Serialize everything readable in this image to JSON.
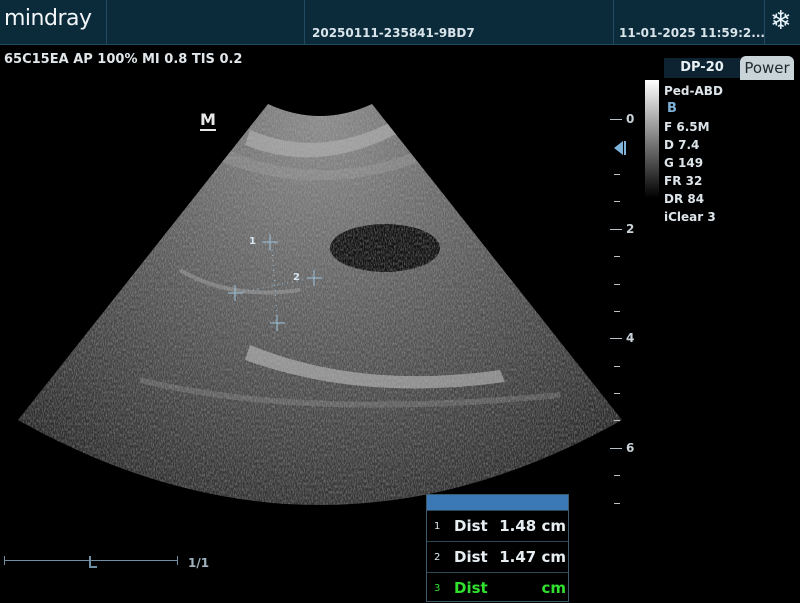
{
  "header": {
    "brand": "mindray",
    "patient_id": "20250111-235841-9BD7",
    "datetime": "11-01-2025 11:59:2...",
    "freeze_icon": "snowflake-icon"
  },
  "probe_info": "65C15EA AP 100%  MI 0.8 TIS 0.2",
  "orientation_marker": "M",
  "depth_scale": {
    "labels": [
      "0",
      "2",
      "4",
      "6"
    ]
  },
  "right_panel": {
    "tab_dp": "DP-20",
    "tab_power": "Power",
    "preset": "Ped-ABD",
    "mode": "B",
    "params": [
      "F 6.5M",
      "D 7.4",
      "G 149",
      "FR 32",
      "DR 84",
      "iClear 3"
    ]
  },
  "calipers": {
    "labels": [
      "1",
      "2"
    ]
  },
  "cine": {
    "page": "1/1",
    "position": 0.5
  },
  "measurements": [
    {
      "num": "1",
      "name": "Dist",
      "value": "1.48 cm",
      "active": false
    },
    {
      "num": "2",
      "name": "Dist",
      "value": "1.47 cm",
      "active": false
    },
    {
      "num": "3",
      "name": "Dist",
      "value": "cm",
      "active": true
    }
  ],
  "colors": {
    "accent": "#3a78b6",
    "active_measure": "#31e02d",
    "topbar": "#0b2a3a"
  }
}
